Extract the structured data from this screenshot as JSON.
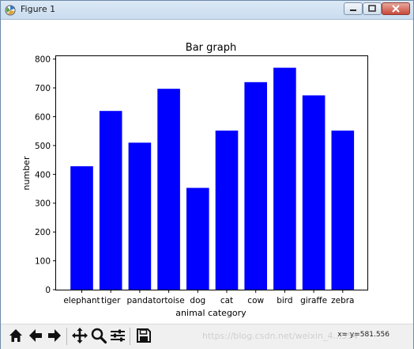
{
  "window": {
    "title": "Figure 1"
  },
  "colors": {
    "bar": "#0000ff",
    "titlebar": "#c9dcef"
  },
  "icons": {
    "app": "matplotlib-icon",
    "home": "home-icon",
    "back": "arrow-left-icon",
    "forward": "arrow-right-icon",
    "pan": "pan-icon",
    "zoom": "zoom-icon",
    "subplots": "configure-subplots-icon",
    "save": "save-icon"
  },
  "toolbar": {
    "coords": "x= y=581.556",
    "watermark": "https://blog.csdn.net/weixin_4...354"
  },
  "chart_data": {
    "type": "bar",
    "title": "Bar graph",
    "xlabel": "animal category",
    "ylabel": "number",
    "categories": [
      "elephant",
      "tiger",
      "panda",
      "tortoise",
      "dog",
      "cat",
      "cow",
      "bird",
      "giraffe",
      "zebra"
    ],
    "values": [
      428,
      620,
      510,
      697,
      353,
      552,
      720,
      770,
      674,
      552
    ],
    "ylim": [
      0,
      810
    ],
    "yticks": [
      0,
      100,
      200,
      300,
      400,
      500,
      600,
      700,
      800
    ],
    "grid": false
  }
}
